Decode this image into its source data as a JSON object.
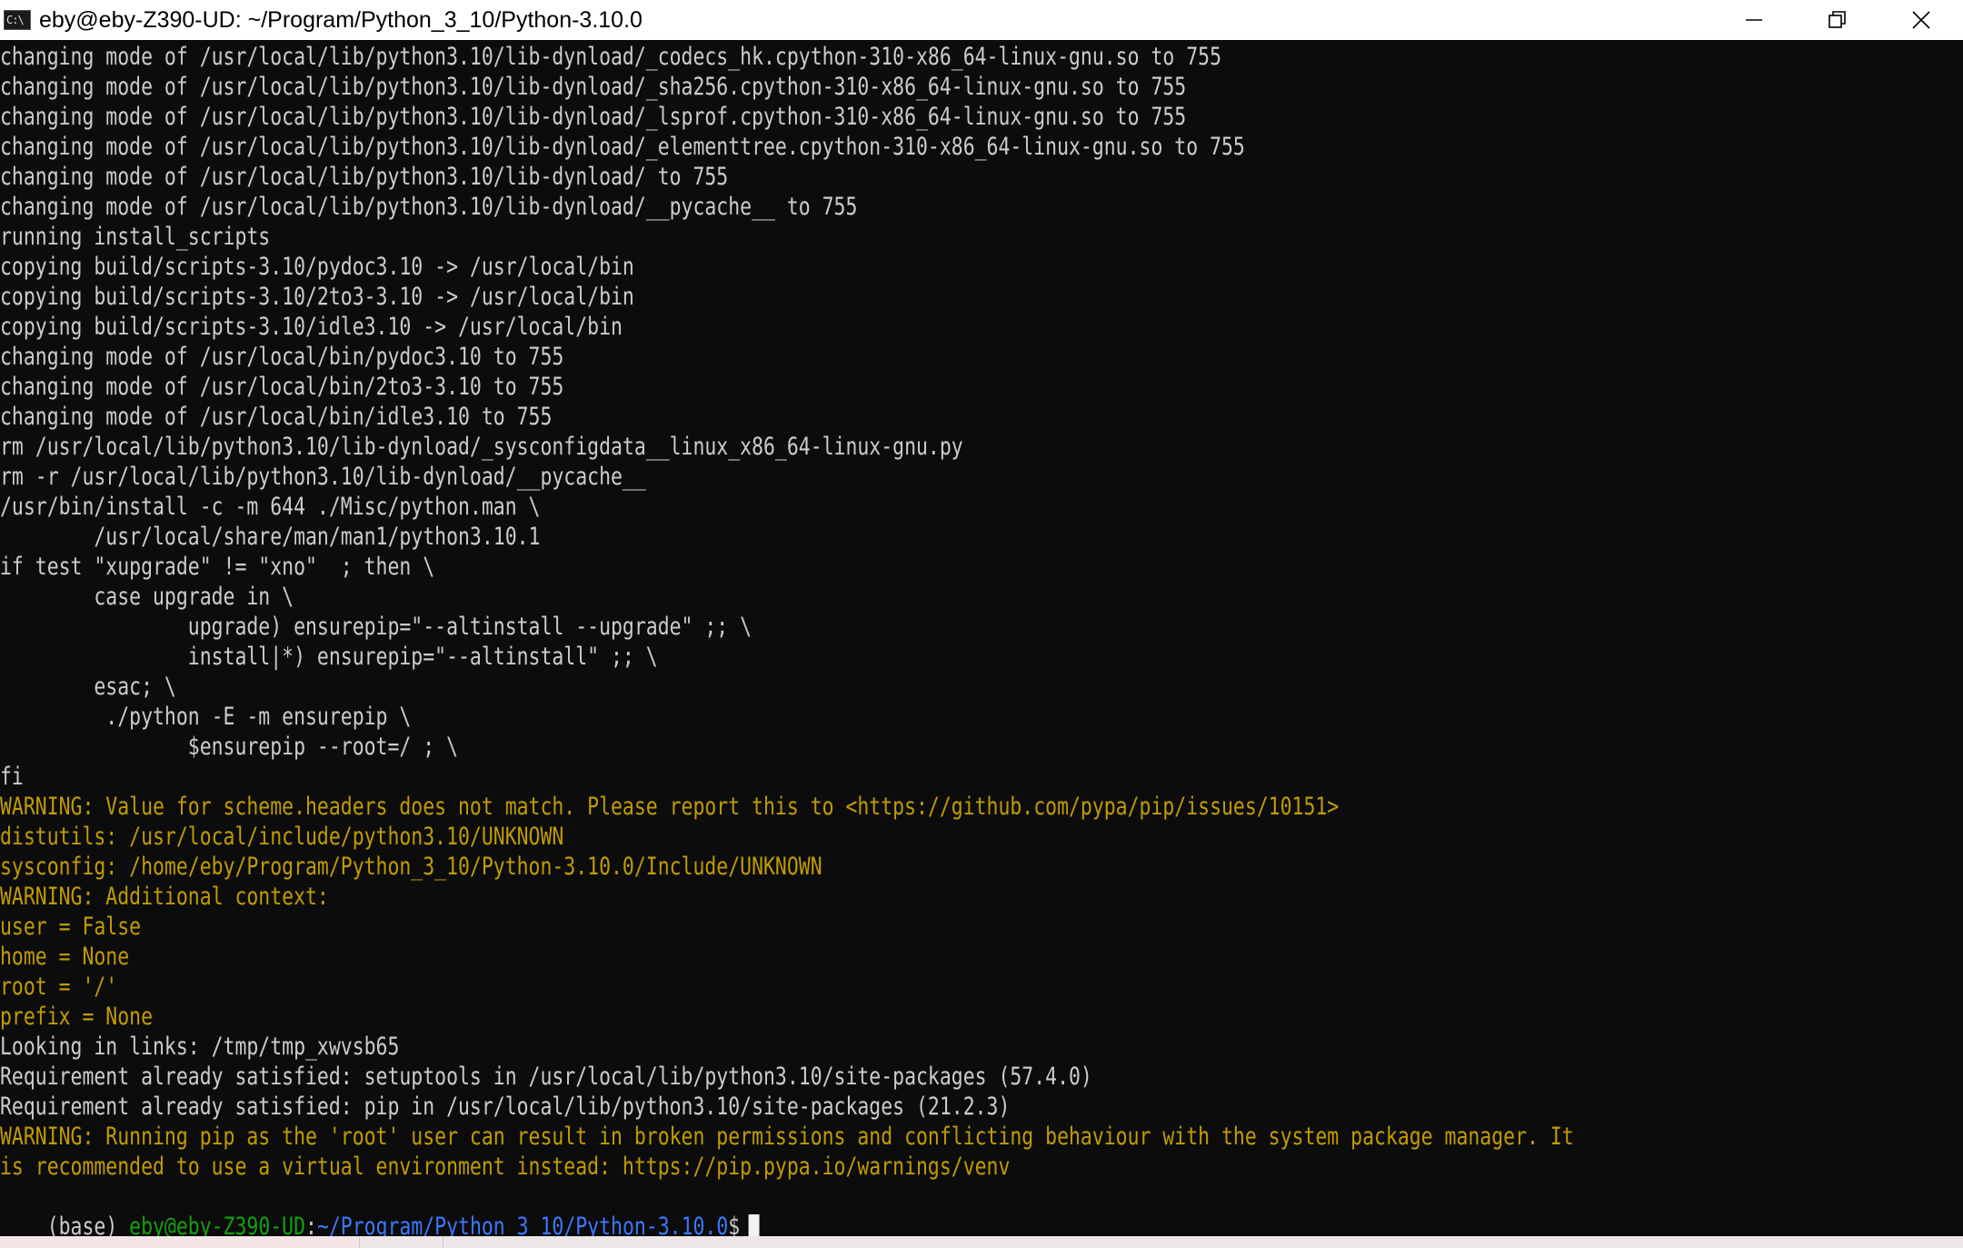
{
  "window": {
    "icon_label": "C:\\",
    "title": "eby@eby-Z390-UD: ~/Program/Python_3_10/Python-3.10.0",
    "controls": [
      "minimize-icon",
      "restore-icon",
      "close-icon"
    ]
  },
  "terminal": {
    "colors": {
      "background": "#0c0c0c",
      "text": "#cccccc",
      "warning": "#c19c00",
      "prompt_user": "#13a10e",
      "prompt_path": "#3b78ff"
    },
    "lines": [
      {
        "text": "changing mode of /usr/local/lib/python3.10/lib-dynload/_codecs_hk.cpython-310-x86_64-linux-gnu.so to 755",
        "style": "normal"
      },
      {
        "text": "changing mode of /usr/local/lib/python3.10/lib-dynload/_sha256.cpython-310-x86_64-linux-gnu.so to 755",
        "style": "normal"
      },
      {
        "text": "changing mode of /usr/local/lib/python3.10/lib-dynload/_lsprof.cpython-310-x86_64-linux-gnu.so to 755",
        "style": "normal"
      },
      {
        "text": "changing mode of /usr/local/lib/python3.10/lib-dynload/_elementtree.cpython-310-x86_64-linux-gnu.so to 755",
        "style": "normal"
      },
      {
        "text": "changing mode of /usr/local/lib/python3.10/lib-dynload/ to 755",
        "style": "normal"
      },
      {
        "text": "changing mode of /usr/local/lib/python3.10/lib-dynload/__pycache__ to 755",
        "style": "normal"
      },
      {
        "text": "running install_scripts",
        "style": "normal"
      },
      {
        "text": "copying build/scripts-3.10/pydoc3.10 -> /usr/local/bin",
        "style": "normal"
      },
      {
        "text": "copying build/scripts-3.10/2to3-3.10 -> /usr/local/bin",
        "style": "normal"
      },
      {
        "text": "copying build/scripts-3.10/idle3.10 -> /usr/local/bin",
        "style": "normal"
      },
      {
        "text": "changing mode of /usr/local/bin/pydoc3.10 to 755",
        "style": "normal"
      },
      {
        "text": "changing mode of /usr/local/bin/2to3-3.10 to 755",
        "style": "normal"
      },
      {
        "text": "changing mode of /usr/local/bin/idle3.10 to 755",
        "style": "normal"
      },
      {
        "text": "rm /usr/local/lib/python3.10/lib-dynload/_sysconfigdata__linux_x86_64-linux-gnu.py",
        "style": "normal"
      },
      {
        "text": "rm -r /usr/local/lib/python3.10/lib-dynload/__pycache__",
        "style": "normal"
      },
      {
        "text": "/usr/bin/install -c -m 644 ./Misc/python.man \\",
        "style": "normal"
      },
      {
        "text": "        /usr/local/share/man/man1/python3.10.1",
        "style": "normal"
      },
      {
        "text": "if test \"xupgrade\" != \"xno\"  ; then \\",
        "style": "normal"
      },
      {
        "text": "        case upgrade in \\",
        "style": "normal"
      },
      {
        "text": "                upgrade) ensurepip=\"--altinstall --upgrade\" ;; \\",
        "style": "normal"
      },
      {
        "text": "                install|*) ensurepip=\"--altinstall\" ;; \\",
        "style": "normal"
      },
      {
        "text": "        esac; \\",
        "style": "normal"
      },
      {
        "text": "         ./python -E -m ensurepip \\",
        "style": "normal"
      },
      {
        "text": "                $ensurepip --root=/ ; \\",
        "style": "normal"
      },
      {
        "text": "fi",
        "style": "normal"
      },
      {
        "text": "WARNING: Value for scheme.headers does not match. Please report this to <https://github.com/pypa/pip/issues/10151>",
        "style": "warn"
      },
      {
        "text": "distutils: /usr/local/include/python3.10/UNKNOWN",
        "style": "warn"
      },
      {
        "text": "sysconfig: /home/eby/Program/Python_3_10/Python-3.10.0/Include/UNKNOWN",
        "style": "warn"
      },
      {
        "text": "WARNING: Additional context:",
        "style": "warn"
      },
      {
        "text": "user = False",
        "style": "warn"
      },
      {
        "text": "home = None",
        "style": "warn"
      },
      {
        "text": "root = '/'",
        "style": "warn"
      },
      {
        "text": "prefix = None",
        "style": "warn"
      },
      {
        "text": "Looking in links: /tmp/tmp_xwvsb65",
        "style": "normal"
      },
      {
        "text": "Requirement already satisfied: setuptools in /usr/local/lib/python3.10/site-packages (57.4.0)",
        "style": "normal"
      },
      {
        "text": "Requirement already satisfied: pip in /usr/local/lib/python3.10/site-packages (21.2.3)",
        "style": "normal"
      },
      {
        "text": "WARNING: Running pip as the 'root' user can result in broken permissions and conflicting behaviour with the system package manager. It",
        "style": "warn"
      },
      {
        "text": "is recommended to use a virtual environment instead: https://pip.pypa.io/warnings/venv",
        "style": "warn"
      }
    ],
    "prompt": {
      "env": "(base) ",
      "user_host": "eby@eby-Z390-UD",
      "colon": ":",
      "path": "~/Program/Python_3_10/Python-3.10.0",
      "dollar": "$"
    }
  }
}
